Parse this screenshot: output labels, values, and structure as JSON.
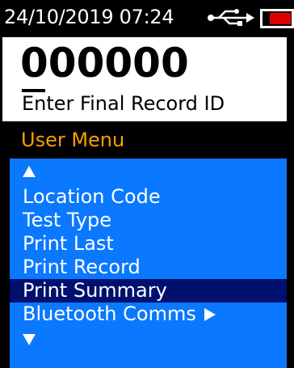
{
  "status_bar": {
    "datetime": "24/10/2019 07:24",
    "usb_icon": "usb-icon",
    "battery_icon": "battery-icon",
    "battery_color": "#e00000"
  },
  "entry": {
    "value": "000000",
    "prompt": "Enter Final Record ID"
  },
  "menu": {
    "title": "User Menu",
    "title_color": "#f5a000",
    "background_color": "#0a78ff",
    "selected_color": "#00106e",
    "scroll_up_icon": "arrow-up-icon",
    "scroll_down_icon": "arrow-down-icon",
    "items": [
      {
        "label": "Location Code"
      },
      {
        "label": "Test Type"
      },
      {
        "label": "Print Last"
      },
      {
        "label": "Print Record"
      },
      {
        "label": "Print Summary",
        "selected": true
      },
      {
        "label": "Bluetooth Comms",
        "submenu_icon": "arrow-right-icon"
      }
    ]
  }
}
